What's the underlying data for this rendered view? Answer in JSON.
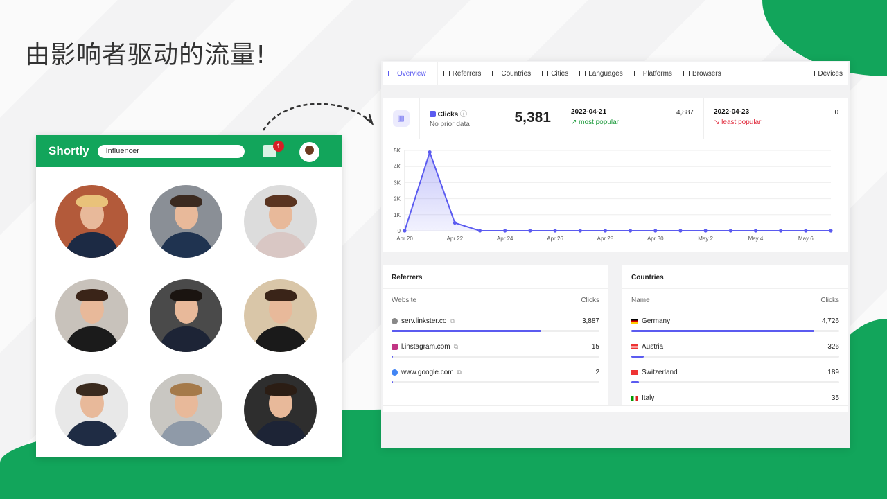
{
  "headline": "由影响者驱动的流量!",
  "colors": {
    "brand_green": "#12a55b",
    "accent": "#5b5bf0",
    "popular": "#1a9a3a",
    "least": "#e0283a"
  },
  "app": {
    "logo": "Shortly",
    "search_value": "Influencer",
    "notification_count": "1",
    "icons": [
      "chat-icon",
      "user-avatar"
    ]
  },
  "dashboard": {
    "tabs": [
      {
        "label": "Overview",
        "icon": "chart-icon",
        "active": true
      },
      {
        "label": "Referrers",
        "icon": "link-icon"
      },
      {
        "label": "Countries",
        "icon": "flag-icon"
      },
      {
        "label": "Cities",
        "icon": "building-icon"
      },
      {
        "label": "Languages",
        "icon": "globe-icon"
      },
      {
        "label": "Platforms",
        "icon": "platform-icon"
      },
      {
        "label": "Browsers",
        "icon": "browser-icon"
      },
      {
        "label": "Devices",
        "icon": "devices-icon"
      }
    ],
    "stats": {
      "metric": "Clicks",
      "sub": "No prior data",
      "total": "5,381",
      "best_date": "2022-04-21",
      "best_value": "4,887",
      "best_label": "most popular",
      "worst_date": "2022-04-23",
      "worst_value": "0",
      "worst_label": "least popular"
    },
    "referrers": {
      "title": "Referrers",
      "col1": "Website",
      "col2": "Clicks",
      "rows": [
        {
          "name": "serv.linkster.co",
          "value": "3,887",
          "pct": 72,
          "icon": "linkster-icon"
        },
        {
          "name": "l.instagram.com",
          "value": "15",
          "pct": 0.4,
          "icon": "instagram-icon"
        },
        {
          "name": "www.google.com",
          "value": "2",
          "pct": 0.1,
          "icon": "google-icon"
        }
      ]
    },
    "countries": {
      "title": "Countries",
      "col1": "Name",
      "col2": "Clicks",
      "rows": [
        {
          "name": "Germany",
          "value": "4,726",
          "pct": 88
        },
        {
          "name": "Austria",
          "value": "326",
          "pct": 6
        },
        {
          "name": "Switzerland",
          "value": "189",
          "pct": 3.5
        },
        {
          "name": "Italy",
          "value": "35",
          "pct": 0.7
        }
      ]
    }
  },
  "chart_data": {
    "type": "area",
    "x": [
      "Apr 20",
      "Apr 21",
      "Apr 22",
      "Apr 23",
      "Apr 24",
      "Apr 25",
      "Apr 26",
      "Apr 27",
      "Apr 28",
      "Apr 29",
      "Apr 30",
      "May 1",
      "May 2",
      "May 3",
      "May 4",
      "May 5",
      "May 6",
      "May 7"
    ],
    "values": [
      0,
      4887,
      494,
      0,
      0,
      0,
      0,
      0,
      0,
      0,
      0,
      0,
      0,
      0,
      0,
      0,
      0,
      0
    ],
    "xticks": [
      "Apr 20",
      "Apr 22",
      "Apr 24",
      "Apr 26",
      "Apr 28",
      "Apr 30",
      "May 2",
      "May 4",
      "May 6"
    ],
    "yticks": [
      "0",
      "1K",
      "2K",
      "3K",
      "4K",
      "5K"
    ],
    "ylim": [
      0,
      5000
    ],
    "grid": true
  }
}
